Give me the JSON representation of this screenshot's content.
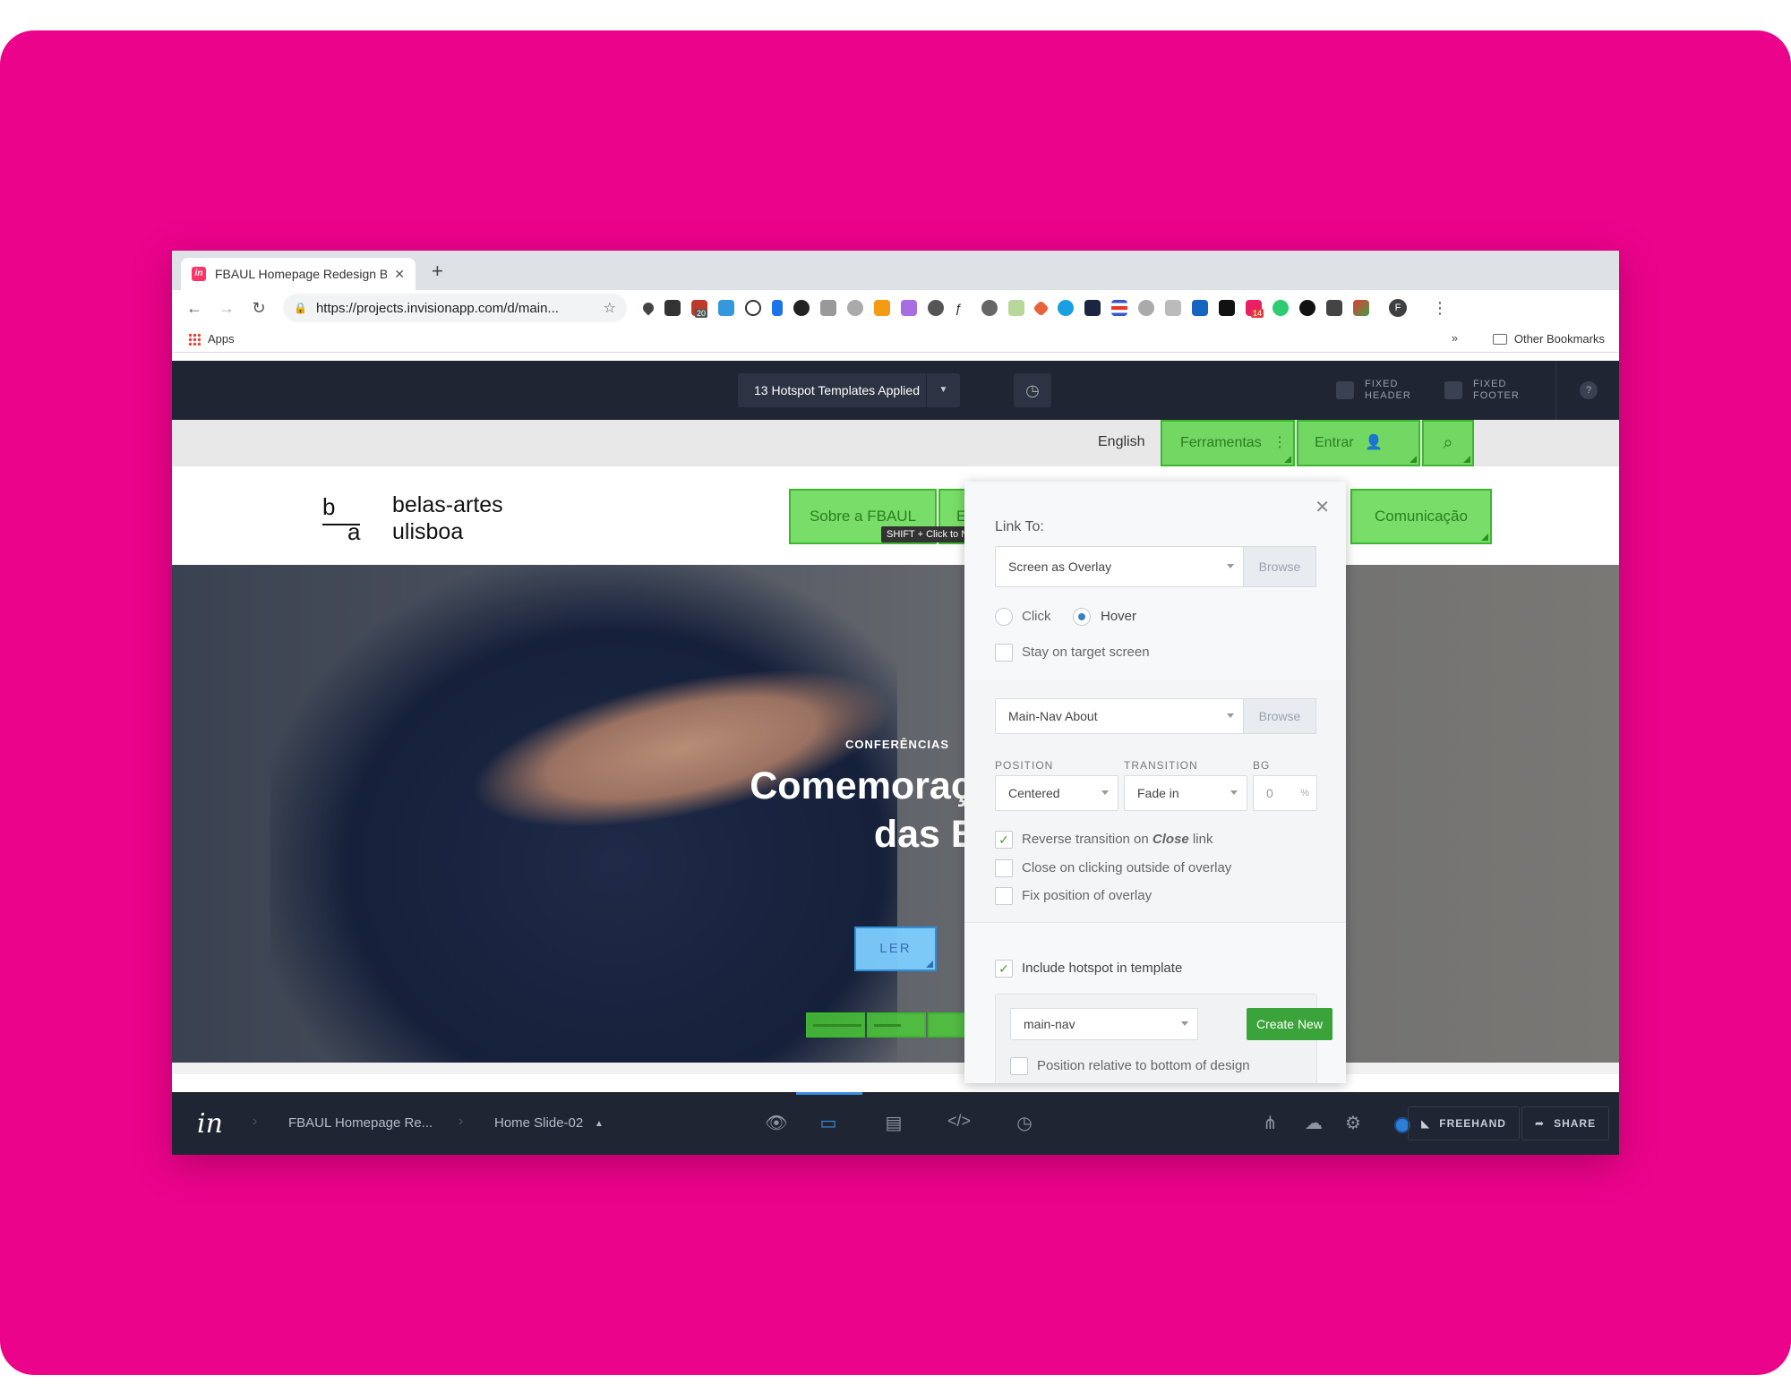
{
  "browser": {
    "tab_title": "FBAUL Homepage Redesign Bu",
    "tab_favicon": "in",
    "url": "https://projects.invisionapp.com/d/main...",
    "bookmarks": {
      "apps_label": "Apps",
      "other_label": "Other Bookmarks"
    },
    "extension_badge_1": "20",
    "extension_badge_2": "14",
    "profile_initial": "F"
  },
  "invision_top": {
    "template_select": "13 Hotspot Templates Applied",
    "fixed_header": "FIXED\nHEADER",
    "fixed_footer": "FIXED\nFOOTER",
    "help": "?"
  },
  "site": {
    "util_nav": {
      "english": "English",
      "ferramentas": "Ferramentas",
      "entrar": "Entrar"
    },
    "logo": {
      "b": "b",
      "a": "a",
      "brand_line1": "belas-artes",
      "brand_line2": "ulisboa"
    },
    "main_nav": {
      "sobre": "Sobre a FBAUL",
      "partial": "E",
      "comunicacao": "Comunicação"
    },
    "tooltip": "SHIFT + Click to Navigate",
    "hero": {
      "kicker": "CONFERÊNCIAS",
      "headline_line1": "Comemorações dc",
      "headline_line2": "das Belas-A",
      "cta": "LER"
    }
  },
  "panel": {
    "link_to_label": "Link To:",
    "link_target": "Screen as Overlay",
    "browse": "Browse",
    "trigger_click": "Click",
    "trigger_hover": "Hover",
    "trigger_selected": "Hover",
    "stay_on_target": "Stay on target screen",
    "screen_name": "Main-Nav About",
    "position_label": "POSITION",
    "transition_label": "TRANSITION",
    "bg_label": "BG",
    "position_value": "Centered",
    "transition_value": "Fade in",
    "bg_value": "0",
    "bg_unit": "%",
    "reverse_transition_pre": "Reverse transition on ",
    "reverse_transition_em": "Close",
    "reverse_transition_post": " link",
    "reverse_checked": true,
    "close_outside": "Close on clicking outside of overlay",
    "fix_position": "Fix position of overlay",
    "include_template": "Include hotspot in template",
    "include_checked": true,
    "template_name": "main-nav",
    "create_new": "Create New",
    "position_relative": "Position relative to bottom of design"
  },
  "invision_bottom": {
    "logo": "in",
    "project": "FBAUL Homepage Re...",
    "screen": "Home Slide-02",
    "freehand": "FREEHAND",
    "share": "SHARE"
  },
  "colors": {
    "background_pink": "#ec038b",
    "invision_dark": "#1f2532",
    "hotspot_green": "#4cd137",
    "active_blue": "#3b8fe0",
    "create_green": "#3aa43a"
  },
  "icons": {
    "modes": [
      "preview-eye-icon",
      "build-hotspot-icon",
      "comment-icon",
      "inspect-code-icon",
      "history-clock-icon"
    ],
    "right": [
      "share-nodes-icon",
      "cloud-sync-icon",
      "settings-gear-icon"
    ]
  }
}
